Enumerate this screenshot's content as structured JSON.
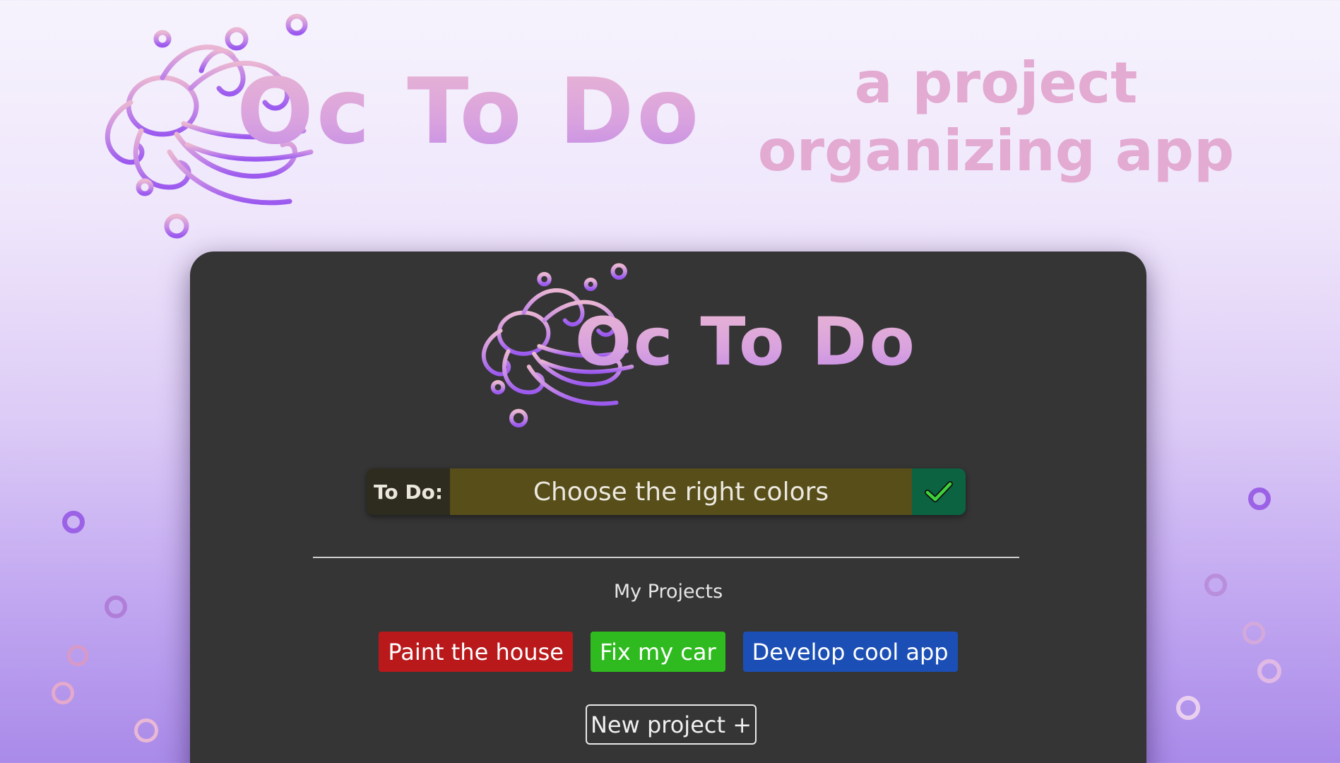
{
  "hero": {
    "title": "Oc To Do",
    "tagline_line1": "a project",
    "tagline_line2": "organizing app"
  },
  "card": {
    "logo_title": "Oc To Do",
    "todo": {
      "label": "To Do:",
      "value": "Choose the right colors",
      "check_icon": "checkmark-icon"
    },
    "projects_heading": "My Projects",
    "projects": [
      {
        "label": "Paint the house",
        "color": "#b9191b"
      },
      {
        "label": "Fix my car",
        "color": "#2fbb1f"
      },
      {
        "label": "Develop cool app",
        "color": "#1c4fb5"
      }
    ],
    "new_project_label": "New project +"
  },
  "colors": {
    "accent_pink": "#e3aad2",
    "accent_purple": "#9d5cf0",
    "card_background": "#353535",
    "todo_background": "#574e19",
    "check_background": "#0b6342"
  }
}
